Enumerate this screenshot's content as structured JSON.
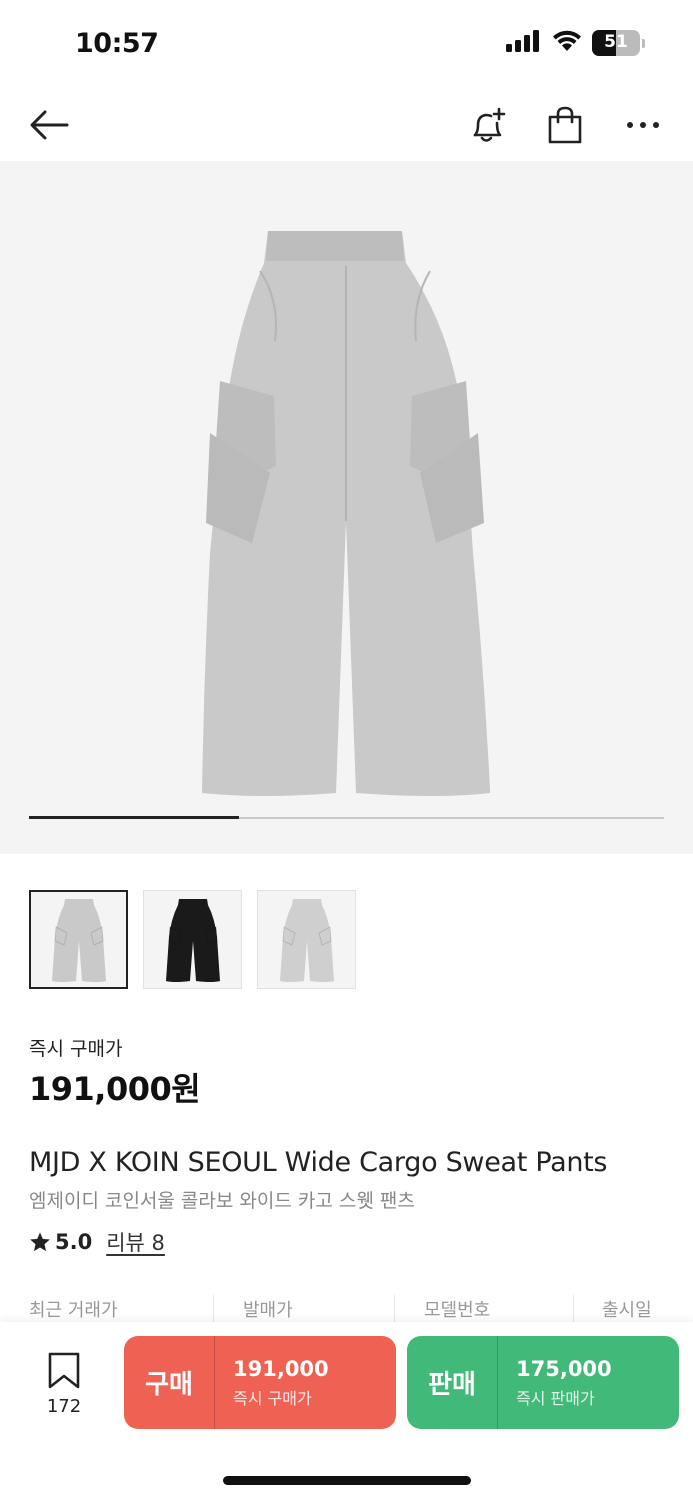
{
  "status_bar": {
    "time": "10:57",
    "battery": "51",
    "battery_level": 0.51
  },
  "nav": {
    "back_icon": "arrow-left-icon",
    "alert_icon": "bell-plus-icon",
    "cart_icon": "shopping-bag-icon",
    "more_icon": "more-horizontal-icon"
  },
  "gallery": {
    "progress": 0.33
  },
  "thumbnails": [
    {
      "name": "thumb-grey",
      "color": "#c9c9c9",
      "active": true
    },
    {
      "name": "thumb-black",
      "color": "#1a1a1a",
      "active": false
    },
    {
      "name": "thumb-light-grey",
      "color": "#cfcfcf",
      "active": false
    }
  ],
  "product": {
    "price_label": "즉시 구매가",
    "price": "191,000원",
    "title_en": "MJD X KOIN SEOUL Wide Cargo Sweat Pants",
    "title_ko": "엠제이디 코인서울 콜라보 와이드 카고 스웻 팬츠",
    "rating": "5.0",
    "review_label": "리뷰 8"
  },
  "info_headers": [
    "최근 거래가",
    "발매가",
    "모델번호",
    "출시일"
  ],
  "bottom_bar": {
    "bookmark_count": "172",
    "buy": {
      "label": "구매",
      "amount": "191,000",
      "sub": "즉시 구매가"
    },
    "sell": {
      "label": "판매",
      "amount": "175,000",
      "sub": "즉시 판매가"
    }
  },
  "colors": {
    "buy": "#ef6253",
    "sell": "#41b979",
    "product": "#c9c9c9"
  }
}
